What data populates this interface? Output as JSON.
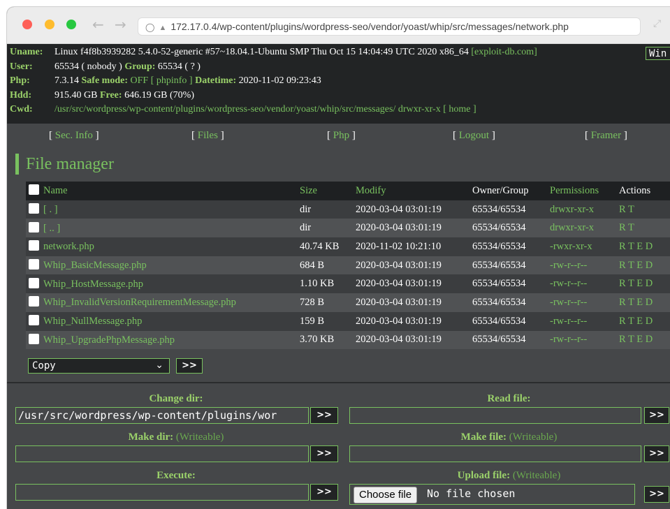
{
  "browser": {
    "url": "172.17.0.4/wp-content/plugins/wordpress-seo/vendor/yoast/whip/src/messages/network.php",
    "back_icon": "arrow-left-icon",
    "forward_icon": "arrow-right-icon"
  },
  "sysinfo": {
    "uname_label": "Uname:",
    "uname_value": "Linux f4f8b3939282 5.4.0-52-generic #57~18.04.1-Ubuntu SMP Thu Oct 15 14:04:49 UTC 2020 x86_64",
    "exploit_link": "[exploit-db.com]",
    "win_button": "Win",
    "user_label": "User:",
    "user_value": "65534 ( nobody )",
    "group_label": "Group:",
    "group_value": "65534 ( ? )",
    "php_label": "Php:",
    "php_value": "7.3.14",
    "safe_mode_label": "Safe mode:",
    "safe_mode_value": "OFF",
    "phpinfo_link": "[ phpinfo ]",
    "datetime_label": "Datetime:",
    "datetime_value": "2020-11-02 09:23:43",
    "hdd_label": "Hdd:",
    "hdd_value": "915.40 GB",
    "free_label": "Free:",
    "free_value": "646.19 GB (70%)",
    "cwd_label": "Cwd:",
    "cwd_value": "/usr/src/wordpress/wp-content/plugins/wordpress-seo/vendor/yoast/whip/src/messages/",
    "cwd_perms": "drwxr-xr-x",
    "home_link": "[ home ]"
  },
  "menu": {
    "sec_info": "Sec. Info",
    "files": "Files",
    "php": "Php",
    "logout": "Logout",
    "framer": "Framer"
  },
  "file_manager": {
    "title": "File manager",
    "headers": {
      "name": "Name",
      "size": "Size",
      "modify": "Modify",
      "owner": "Owner/Group",
      "permissions": "Permissions",
      "actions": "Actions"
    },
    "rows": [
      {
        "name": "[ . ]",
        "size": "dir",
        "modify": "2020-03-04 03:01:19",
        "owner": "65534/65534",
        "perms": "drwxr-xr-x",
        "actions": "R T"
      },
      {
        "name": "[ .. ]",
        "size": "dir",
        "modify": "2020-03-04 03:01:19",
        "owner": "65534/65534",
        "perms": "drwxr-xr-x",
        "actions": "R T"
      },
      {
        "name": "network.php",
        "size": "40.74 KB",
        "modify": "2020-11-02 10:21:10",
        "owner": "65534/65534",
        "perms": "-rwxr-xr-x",
        "actions": "R T E D"
      },
      {
        "name": "Whip_BasicMessage.php",
        "size": "684 B",
        "modify": "2020-03-04 03:01:19",
        "owner": "65534/65534",
        "perms": "-rw-r--r--",
        "actions": "R T E D"
      },
      {
        "name": "Whip_HostMessage.php",
        "size": "1.10 KB",
        "modify": "2020-03-04 03:01:19",
        "owner": "65534/65534",
        "perms": "-rw-r--r--",
        "actions": "R T E D"
      },
      {
        "name": "Whip_InvalidVersionRequirementMessage.php",
        "size": "728 B",
        "modify": "2020-03-04 03:01:19",
        "owner": "65534/65534",
        "perms": "-rw-r--r--",
        "actions": "R T E D"
      },
      {
        "name": "Whip_NullMessage.php",
        "size": "159 B",
        "modify": "2020-03-04 03:01:19",
        "owner": "65534/65534",
        "perms": "-rw-r--r--",
        "actions": "R T E D"
      },
      {
        "name": "Whip_UpgradePhpMessage.php",
        "size": "3.70 KB",
        "modify": "2020-03-04 03:01:19",
        "owner": "65534/65534",
        "perms": "-rw-r--r--",
        "actions": "R T E D"
      }
    ],
    "action_select": "Copy",
    "go_label": ">>"
  },
  "forms": {
    "change_dir_title": "Change dir:",
    "change_dir_value": "/usr/src/wordpress/wp-content/plugins/wor",
    "read_file_title": "Read file:",
    "make_dir_title": "Make dir:",
    "make_file_title": "Make file:",
    "writeable": "(Writeable)",
    "execute_title": "Execute:",
    "upload_title": "Upload file:",
    "choose_file": "Choose file",
    "no_file": "No file chosen",
    "submit": ">>"
  },
  "colors": {
    "accent_green": "#79c15f",
    "label_green": "#9bd26a",
    "page_bg": "#454749",
    "header_bg": "#222425"
  }
}
